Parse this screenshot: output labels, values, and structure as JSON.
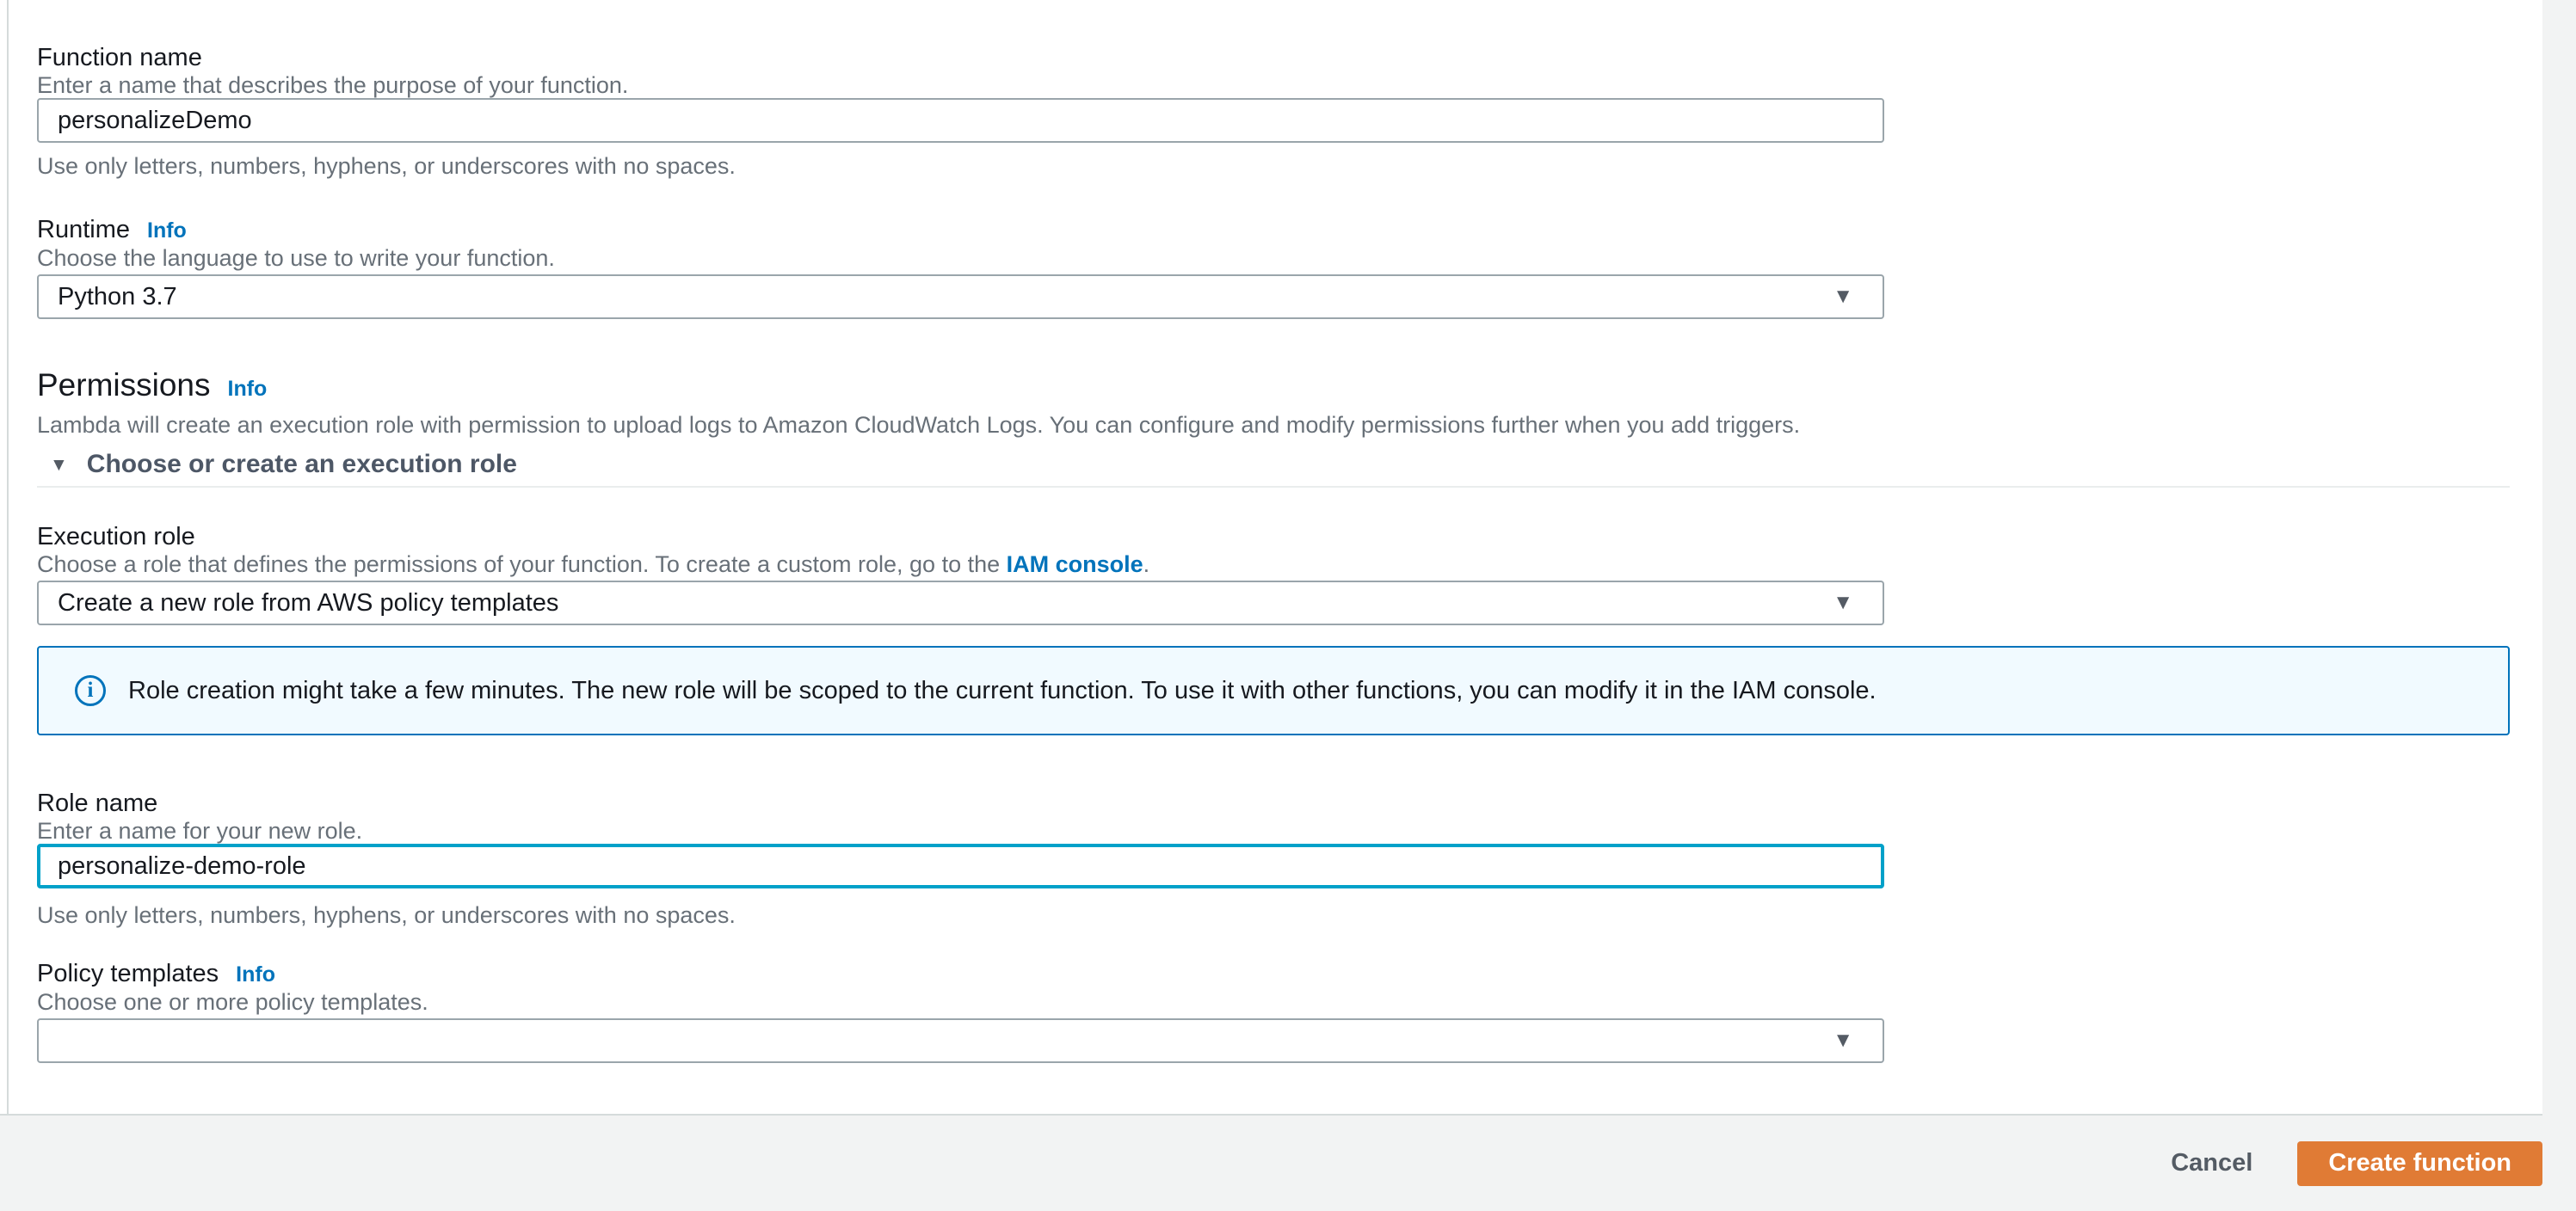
{
  "form": {
    "function_name": {
      "label": "Function name",
      "description": "Enter a name that describes the purpose of your function.",
      "value": "personalizeDemo",
      "helper": "Use only letters, numbers, hyphens, or underscores with no spaces."
    },
    "runtime": {
      "label": "Runtime",
      "info_label": "Info",
      "description": "Choose the language to use to write your function.",
      "value": "Python 3.7"
    },
    "permissions": {
      "heading": "Permissions",
      "info_label": "Info",
      "description": "Lambda will create an execution role with permission to upload logs to Amazon CloudWatch Logs. You can configure and modify permissions further when you add triggers.",
      "expander_label": "Choose or create an execution role"
    },
    "execution_role": {
      "label": "Execution role",
      "description_prefix": "Choose a role that defines the permissions of your function. To create a custom role, go to the ",
      "link_text": "IAM console",
      "description_suffix": ".",
      "value": "Create a new role from AWS policy templates"
    },
    "role_alert": {
      "text": "Role creation might take a few minutes. The new role will be scoped to the current function. To use it with other functions, you can modify it in the IAM console."
    },
    "role_name": {
      "label": "Role name",
      "description": "Enter a name for your new role.",
      "value": "personalize-demo-role",
      "helper": "Use only letters, numbers, hyphens, or underscores with no spaces."
    },
    "policy_templates": {
      "label": "Policy templates",
      "info_label": "Info",
      "description": "Choose one or more policy templates.",
      "value": ""
    }
  },
  "footer": {
    "cancel_label": "Cancel",
    "create_label": "Create function"
  },
  "icons": {
    "dropdown_caret": "▼",
    "expander_caret": "▼",
    "info_circle": "i"
  },
  "colors": {
    "link_blue": "#0073bb",
    "accent_orange": "#e07b35",
    "focus_teal": "#00a1c9",
    "alert_bg": "#f1faff",
    "alert_border": "#0073bb",
    "text_dark": "#16191f",
    "text_grey": "#687078",
    "border_grey": "#9aa5ab",
    "page_grey": "#f2f3f3",
    "slate": "#545b64"
  }
}
